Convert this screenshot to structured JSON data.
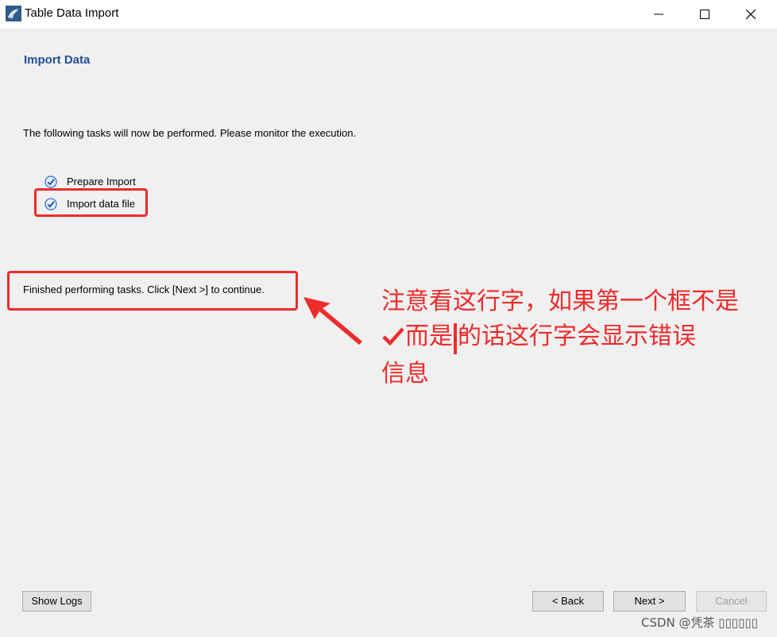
{
  "window": {
    "title": "Table Data Import"
  },
  "page": {
    "heading": "Import Data",
    "description": "The following tasks will now be performed. Please monitor the execution.",
    "tasks": [
      {
        "label": "Prepare Import",
        "status": "done"
      },
      {
        "label": "Import data file",
        "status": "done"
      }
    ],
    "status_message": "Finished performing tasks. Click [Next >] to continue."
  },
  "annotation": {
    "line1": "注意看这行字，如果第一个框不是",
    "line2_a": "而是",
    "line2_b": "的话这行字会显示错误",
    "line3": "信息",
    "color": "#ef2b2b"
  },
  "buttons": {
    "show_logs": "Show Logs",
    "back": "< Back",
    "next": "Next >",
    "cancel": "Cancel"
  },
  "watermark": "CSDN @凭茶 ▯▯▯▯▯▯",
  "colors": {
    "heading": "#1f4e99",
    "highlight": "#ef2b2b",
    "check_blue": "#2f6fd6"
  }
}
